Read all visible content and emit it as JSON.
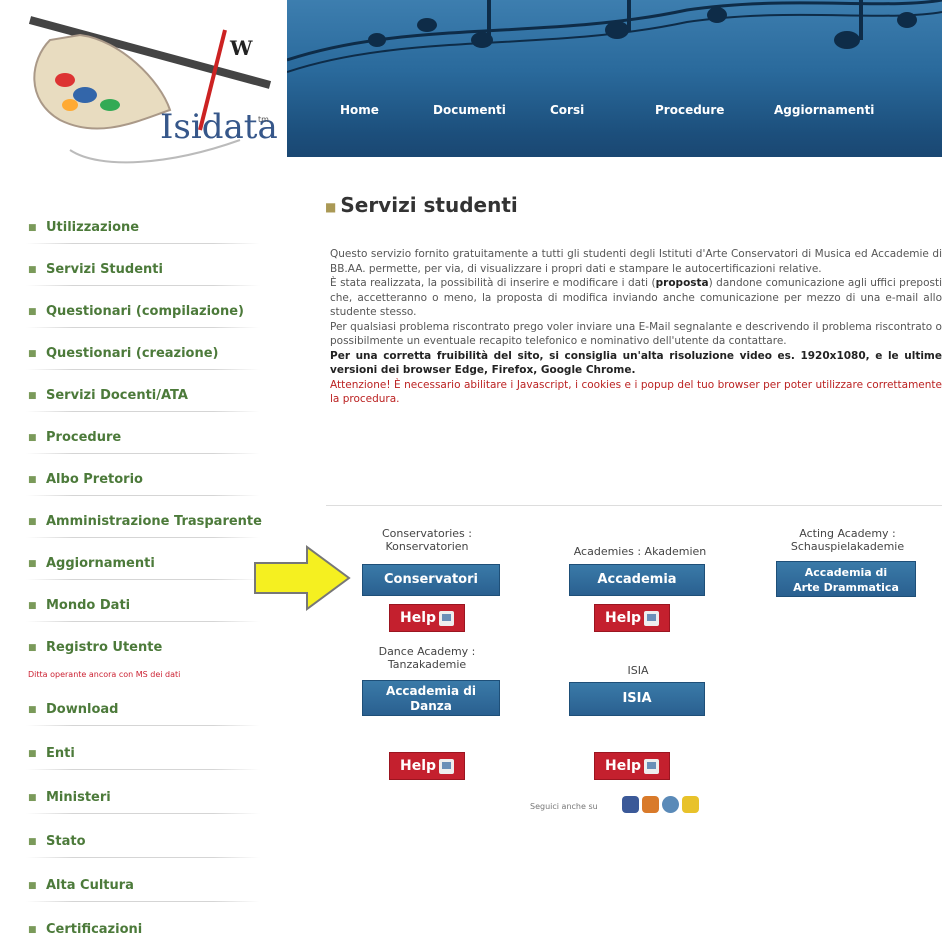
{
  "logo": {
    "text": "Isidata",
    "tm": "tm"
  },
  "nav": [
    {
      "label": "Home"
    },
    {
      "label": "Documenti"
    },
    {
      "label": "Corsi"
    },
    {
      "label": "Procedure"
    },
    {
      "label": "Aggiornamenti"
    }
  ],
  "sidebar": {
    "items": [
      {
        "label": "Utilizzazione"
      },
      {
        "label": "Servizi Studenti"
      },
      {
        "label": "Questionari (compilazione)"
      },
      {
        "label": "Questionari (creazione)"
      },
      {
        "label": "Servizi Docenti/ATA"
      },
      {
        "label": "Procedure"
      },
      {
        "label": "Albo Pretorio"
      },
      {
        "label": "Amministrazione Trasparente"
      },
      {
        "label": "Aggiornamenti"
      },
      {
        "label": "Mondo Dati"
      },
      {
        "label": "Registro Utente"
      },
      {
        "label": "Download"
      },
      {
        "label": "Enti"
      },
      {
        "label": "Ministeri"
      },
      {
        "label": "Stato"
      },
      {
        "label": "Alta Cultura"
      },
      {
        "label": "Certificazioni"
      }
    ],
    "note": "Ditta operante ancora con MS dei dati"
  },
  "main": {
    "title": "Servizi studenti",
    "p1": "Questo servizio fornito gratuitamente a tutti gli studenti degli Istituti d'Arte Conservatori di Musica ed Accademie di BB.AA. permette, per via, di visualizzare i propri dati e stampare le autocertificazioni relative.",
    "p2a": "È stata realizzata, la possibilità di inserire e modificare i dati (",
    "p2b": "proposta",
    "p2c": ") dandone comunicazione agli uffici preposti che, accetteranno o meno, la proposta di modifica inviando anche comunicazione per mezzo di una e-mail allo studente stesso.",
    "p3": "Per qualsiasi problema riscontrato prego voler inviare una E-Mail segnalante e descrivendo il problema riscontrato o possibilmente un eventuale recapito telefonico e nominativo dell'utente da contattare.",
    "p4": "Per una corretta fruibilità del sito, si consiglia un'alta risoluzione video es. 1920x1080, e le ultime versioni dei browser Edge, Firefox, Google Chrome.",
    "p5": "Attenzione! È necessario abilitare i Javascript, i cookies e i popup del tuo browser per poter utilizzare correttamente la procedura."
  },
  "services": [
    {
      "caption1": "Conservatories :",
      "caption2": "Konservatorien",
      "button": "Conservatori",
      "help": "Help"
    },
    {
      "caption1": "Academies : Akademien",
      "caption2": "",
      "button": "Accademia",
      "help": "Help"
    },
    {
      "caption1": "Acting Academy :",
      "caption2": "Schauspielakademie",
      "button1": "Accademia di",
      "button2": "Arte Drammatica"
    },
    {
      "caption1": "Dance Academy :",
      "caption2": "Tanzakademie",
      "button1": "Accademia di",
      "button2": "Danza",
      "help": "Help"
    },
    {
      "caption1": "ISIA",
      "caption2": "",
      "button": "ISIA",
      "help": "Help"
    }
  ],
  "social": {
    "label": "Seguici anche su"
  },
  "colors": {
    "nav_bg": "#2a6a9c",
    "sidebar_text": "#4c7a3a",
    "button_bg": "#2a6090",
    "help_bg": "#c4202e",
    "arrow": "#f5f020"
  }
}
